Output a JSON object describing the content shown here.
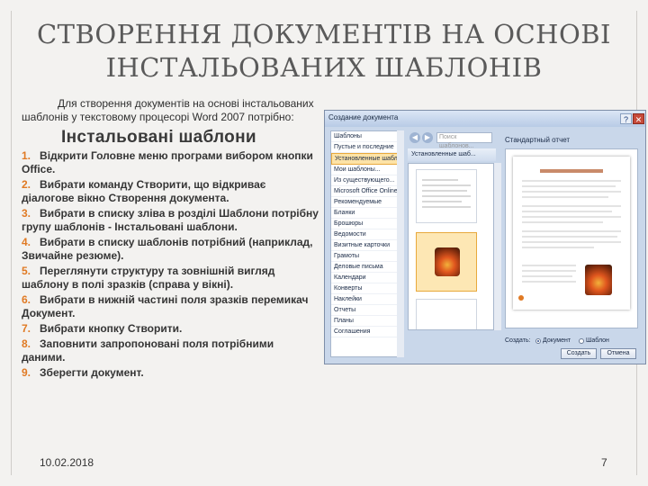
{
  "slide": {
    "title_line1": "СТВОРЕННЯ ДОКУМЕНТІВ НА ОСНОВІ",
    "title_line2": "ІНСТАЛЬОВАНИХ ШАБЛОНІВ",
    "intro": "Для створення документів на основі інстальованих шаблонів у текстовому процесорі Word 2007 потрібно:",
    "heading": "Інстальовані шаблони",
    "steps": [
      {
        "num": "1.",
        "text": "Відкрити Головне меню програми вибором кнопки Office."
      },
      {
        "num": "2.",
        "text": "Вибрати команду Створити, що відкриває діалогове вікно Створення документа."
      },
      {
        "num": "3.",
        "text": "Вибрати в списку зліва в розділі Шаблони потрібну групу шаблонів - Інстальовані шаблони."
      },
      {
        "num": "4.",
        "text": "Вибрати в списку шаблонів потрібний (наприклад, Звичайне резюме)."
      },
      {
        "num": "5.",
        "text": "Переглянути структуру та зовнішній вигляд шаблону в полі зразків (справа у вікні)."
      },
      {
        "num": "6.",
        "text": "Вибрати в нижній частині поля зразків перемикач Документ."
      },
      {
        "num": "7.",
        "text": "Вибрати кнопку Створити."
      },
      {
        "num": "8.",
        "text": "Заповнити запропоновані поля потрібними даними."
      },
      {
        "num": "9.",
        "text": "Зберегти документ."
      }
    ],
    "date": "10.02.2018",
    "page_number": "7"
  },
  "screenshot": {
    "window_title": "Создание документа",
    "help_glyph": "?",
    "close_glyph": "✕",
    "search_placeholder": "Поиск шаблонов...",
    "nav_items": [
      {
        "label": "Шаблоны",
        "selected": false
      },
      {
        "label": "Пустые и последние",
        "selected": false
      },
      {
        "label": "Установленные шаблоны",
        "selected": true
      },
      {
        "label": "Мои шаблоны...",
        "selected": false
      },
      {
        "label": "Из существующего...",
        "selected": false
      },
      {
        "label": "Microsoft Office Online",
        "selected": false
      },
      {
        "label": "Рекомендуемые",
        "selected": false
      },
      {
        "label": "Бланки",
        "selected": false
      },
      {
        "label": "Брошюры",
        "selected": false
      },
      {
        "label": "Ведомости",
        "selected": false
      },
      {
        "label": "Визитные карточки",
        "selected": false
      },
      {
        "label": "Грамоты",
        "selected": false
      },
      {
        "label": "Деловые письма",
        "selected": false
      },
      {
        "label": "Календари",
        "selected": false
      },
      {
        "label": "Конверты",
        "selected": false
      },
      {
        "label": "Наклейки",
        "selected": false
      },
      {
        "label": "Отчеты",
        "selected": false
      },
      {
        "label": "Планы",
        "selected": false
      },
      {
        "label": "Соглашения",
        "selected": false
      }
    ],
    "category_heading": "Установленные шаб...",
    "preview_title": "Стандартный отчет",
    "create_label": "Создать:",
    "radio_document": "Документ",
    "radio_template": "Шаблон",
    "button_create": "Создать",
    "button_cancel": "Отмена"
  }
}
